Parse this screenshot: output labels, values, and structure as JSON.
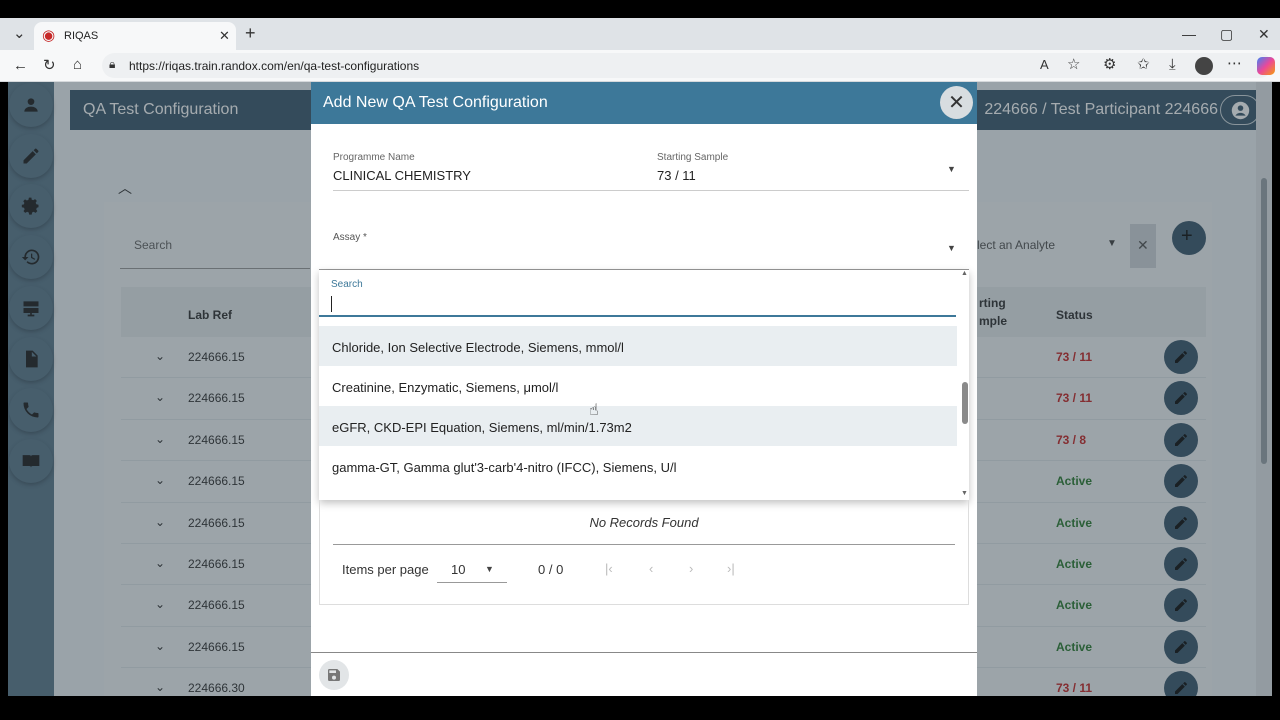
{
  "browser": {
    "tab_title": "RIQAS",
    "url": "https://riqas.train.randox.com/en/qa-test-configurations"
  },
  "app": {
    "page_title": "QA Test Configuration",
    "user_label": "224666 / Test Participant 224666",
    "search_placeholder": "Search",
    "analyte_placeholder": "lect an Analyte",
    "table": {
      "col_labref": "Lab Ref",
      "col_sample_line1": "rting",
      "col_sample_line2": "mple",
      "col_status": "Status",
      "rows": [
        {
          "labref": "224666.15",
          "status": "73 / 11",
          "status_color": "#c62828"
        },
        {
          "labref": "224666.15",
          "status": "73 / 11",
          "status_color": "#c62828"
        },
        {
          "labref": "224666.15",
          "status": "73 / 8",
          "status_color": "#c62828"
        },
        {
          "labref": "224666.15",
          "status": "Active",
          "status_color": "#2e7d32"
        },
        {
          "labref": "224666.15",
          "status": "Active",
          "status_color": "#2e7d32"
        },
        {
          "labref": "224666.15",
          "status": "Active",
          "status_color": "#2e7d32"
        },
        {
          "labref": "224666.15",
          "status": "Active",
          "status_color": "#2e7d32"
        },
        {
          "labref": "224666.15",
          "status": "Active",
          "status_color": "#2e7d32"
        },
        {
          "labref": "224666.30",
          "status": "73 / 11",
          "status_color": "#c62828"
        }
      ]
    }
  },
  "dialog": {
    "title": "Add New QA Test Configuration",
    "programme_label": "Programme Name",
    "programme_value": "CLINICAL CHEMISTRY",
    "sample_label": "Starting Sample",
    "sample_value": "73 / 11",
    "assay_label": "Assay *",
    "search_label": "Search",
    "options": [
      "Chloride, Ion Selective Electrode, Siemens, mmol/l",
      "Creatinine, Enzymatic, Siemens, μmol/l",
      "eGFR, CKD-EPI Equation, Siemens, ml/min/1.73m2",
      "gamma-GT, Gamma glut'3-carb'4-nitro (IFCC), Siemens, U/l"
    ],
    "no_records": "No Records Found",
    "items_per_page_label": "Items per page",
    "items_per_page_value": "10",
    "range_label": "0 / 0"
  },
  "colors": {
    "header": "#3d5b6f",
    "dialog_header": "#3d7899",
    "sidebar": "#5d7a8c"
  }
}
